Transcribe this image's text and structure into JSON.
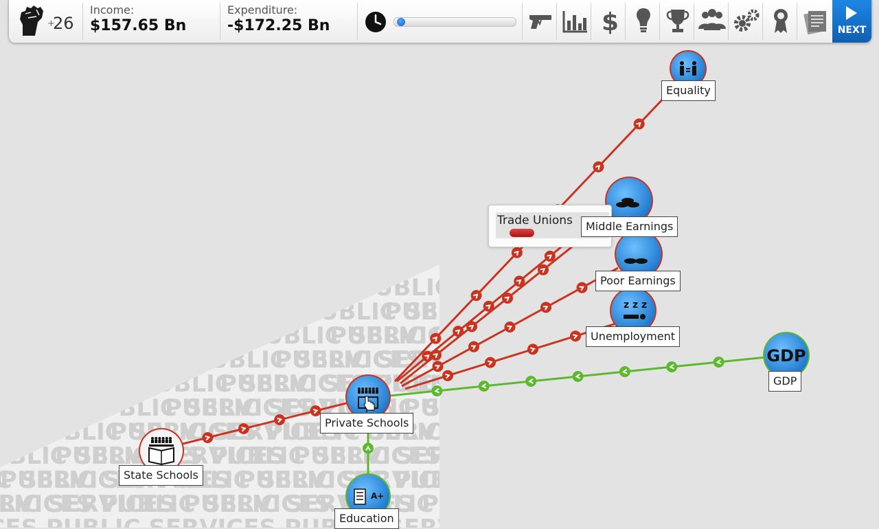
{
  "topbar": {
    "political_capital": {
      "icon": "raised-fist-icon",
      "plus_sign": "+",
      "value": "26"
    },
    "income": {
      "label": "Income:",
      "value": "$157.65 Bn"
    },
    "expenditure": {
      "label": "Expenditure:",
      "value": "-$172.25 Bn"
    },
    "clock_icon": "clock-icon",
    "turn_progress": 0.02,
    "toolbar_icons": [
      "pistol-icon",
      "bar-chart-icon",
      "dollar-icon",
      "lightbulb-icon",
      "trophy-icon",
      "people-icon",
      "gears-icon",
      "ribbon-award-icon",
      "documents-icon"
    ],
    "next_label": "NEXT"
  },
  "map": {
    "watermark_text": "PUBLIC SERVICES",
    "nodes": {
      "equality": {
        "label": "Equality",
        "icon": "equality-icon"
      },
      "middle_earnings": {
        "label": "Middle Earnings",
        "icon": "coins-stack-icon"
      },
      "poor_earnings": {
        "label": "Poor Earnings",
        "icon": "coins-few-icon"
      },
      "unemployment": {
        "label": "Unemployment",
        "icon": "sleeping-icon"
      },
      "gdp": {
        "label": "GDP",
        "icon_text": "GDP"
      },
      "private_schools": {
        "label": "Private Schools",
        "icon": "school-icon"
      },
      "state_schools": {
        "label": "State Schools",
        "icon": "school-book-icon"
      },
      "education": {
        "label": "Education",
        "icon_text": "A+"
      }
    },
    "tooltip": {
      "title": "Trade Unions",
      "level": 0.2
    }
  },
  "colors": {
    "negative_link": "#c8341f",
    "positive_link": "#5cb82d",
    "node_blue": "#2e8fe0",
    "accent": "#1d87e5"
  }
}
